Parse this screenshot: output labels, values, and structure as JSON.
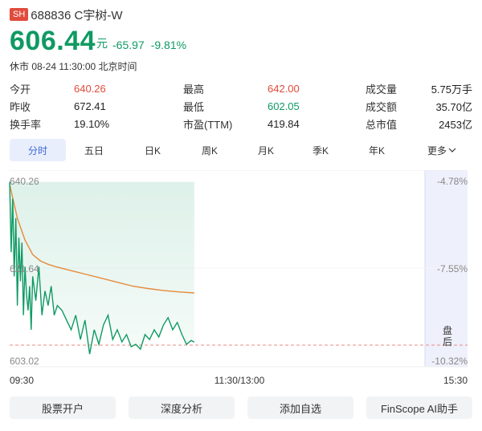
{
  "header": {
    "exchange_badge": "SH",
    "title": "688836 C宇树-W"
  },
  "quote": {
    "price": "606.44",
    "unit": "元",
    "change": "-65.97",
    "change_pct": "-9.81%",
    "status": "休市 08-24 11:30:00 北京时间"
  },
  "stats": [
    [
      {
        "label": "今开",
        "value": "640.26",
        "tone": "red"
      },
      {
        "label": "最高",
        "value": "642.00",
        "tone": "red"
      },
      {
        "label": "成交量",
        "value": "5.75万手",
        "tone": "plain"
      }
    ],
    [
      {
        "label": "昨收",
        "value": "672.41",
        "tone": "plain"
      },
      {
        "label": "最低",
        "value": "602.05",
        "tone": "green"
      },
      {
        "label": "成交额",
        "value": "35.70亿",
        "tone": "plain"
      }
    ],
    [
      {
        "label": "换手率",
        "value": "19.10%",
        "tone": "plain"
      },
      {
        "label": "市盈(TTM)",
        "value": "419.84",
        "tone": "plain"
      },
      {
        "label": "总市值",
        "value": "2453亿",
        "tone": "plain"
      }
    ]
  ],
  "tabs": [
    "分时",
    "五日",
    "日K",
    "周K",
    "月K",
    "季K",
    "年K",
    "更多"
  ],
  "chart_data": {
    "type": "line",
    "y_left_ticks": [
      "640.26",
      "621.64",
      "603.02"
    ],
    "y_right_ticks": [
      "-4.78%",
      "-7.55%",
      "-10.32%"
    ],
    "ylim": [
      603.02,
      640.26
    ],
    "prev_close": 672.41,
    "x_ticks": [
      "09:30",
      "11:30/13:00",
      "15:30"
    ],
    "after_hours_label": "盘后",
    "series": [
      {
        "role": "price",
        "color": "#0f9a63",
        "x": [
          "09:30",
          "09:31",
          "09:32",
          "09:33",
          "09:34",
          "09:35",
          "09:36",
          "09:37",
          "09:38",
          "09:39",
          "09:40",
          "09:41",
          "09:42",
          "09:43",
          "09:44",
          "09:45",
          "09:47",
          "09:49",
          "09:51",
          "09:53",
          "09:55",
          "09:57",
          "09:59",
          "10:01",
          "10:04",
          "10:07",
          "10:10",
          "10:13",
          "10:16",
          "10:19",
          "10:22",
          "10:25",
          "10:28",
          "10:31",
          "10:34",
          "10:37",
          "10:40",
          "10:43",
          "10:46",
          "10:49",
          "10:52",
          "10:55",
          "10:58",
          "11:01",
          "11:04",
          "11:07",
          "11:10",
          "11:13",
          "11:16",
          "11:19",
          "11:22",
          "11:25",
          "11:28",
          "11:30"
        ],
        "values": [
          639.5,
          625.0,
          636.0,
          620.0,
          632.0,
          614.0,
          628.0,
          619.0,
          627.0,
          612.0,
          622.0,
          616.0,
          613.0,
          618.0,
          609.0,
          620.0,
          615.0,
          622.0,
          612.0,
          617.0,
          614.0,
          618.0,
          612.0,
          614.0,
          613.0,
          611.0,
          609.0,
          612.0,
          607.0,
          611.0,
          604.0,
          609.0,
          606.0,
          610.0,
          612.0,
          607.0,
          609.0,
          606.5,
          608.0,
          605.5,
          606.0,
          605.0,
          608.0,
          607.0,
          609.0,
          607.5,
          610.0,
          611.5,
          609.0,
          610.5,
          608.0,
          606.0,
          606.8,
          606.44
        ]
      },
      {
        "role": "average",
        "color": "#e68a3a",
        "x": [
          "09:30",
          "09:35",
          "09:40",
          "09:45",
          "09:50",
          "09:55",
          "10:00",
          "10:10",
          "10:20",
          "10:30",
          "10:40",
          "10:50",
          "11:00",
          "11:10",
          "11:20",
          "11:30"
        ],
        "values": [
          639.0,
          632.0,
          627.5,
          624.5,
          623.2,
          622.5,
          622.0,
          621.2,
          620.4,
          619.6,
          618.8,
          618.0,
          617.5,
          617.1,
          616.8,
          616.6
        ]
      }
    ]
  },
  "actions": [
    "股票开户",
    "深度分析",
    "添加自选",
    "FinScope AI助手"
  ]
}
